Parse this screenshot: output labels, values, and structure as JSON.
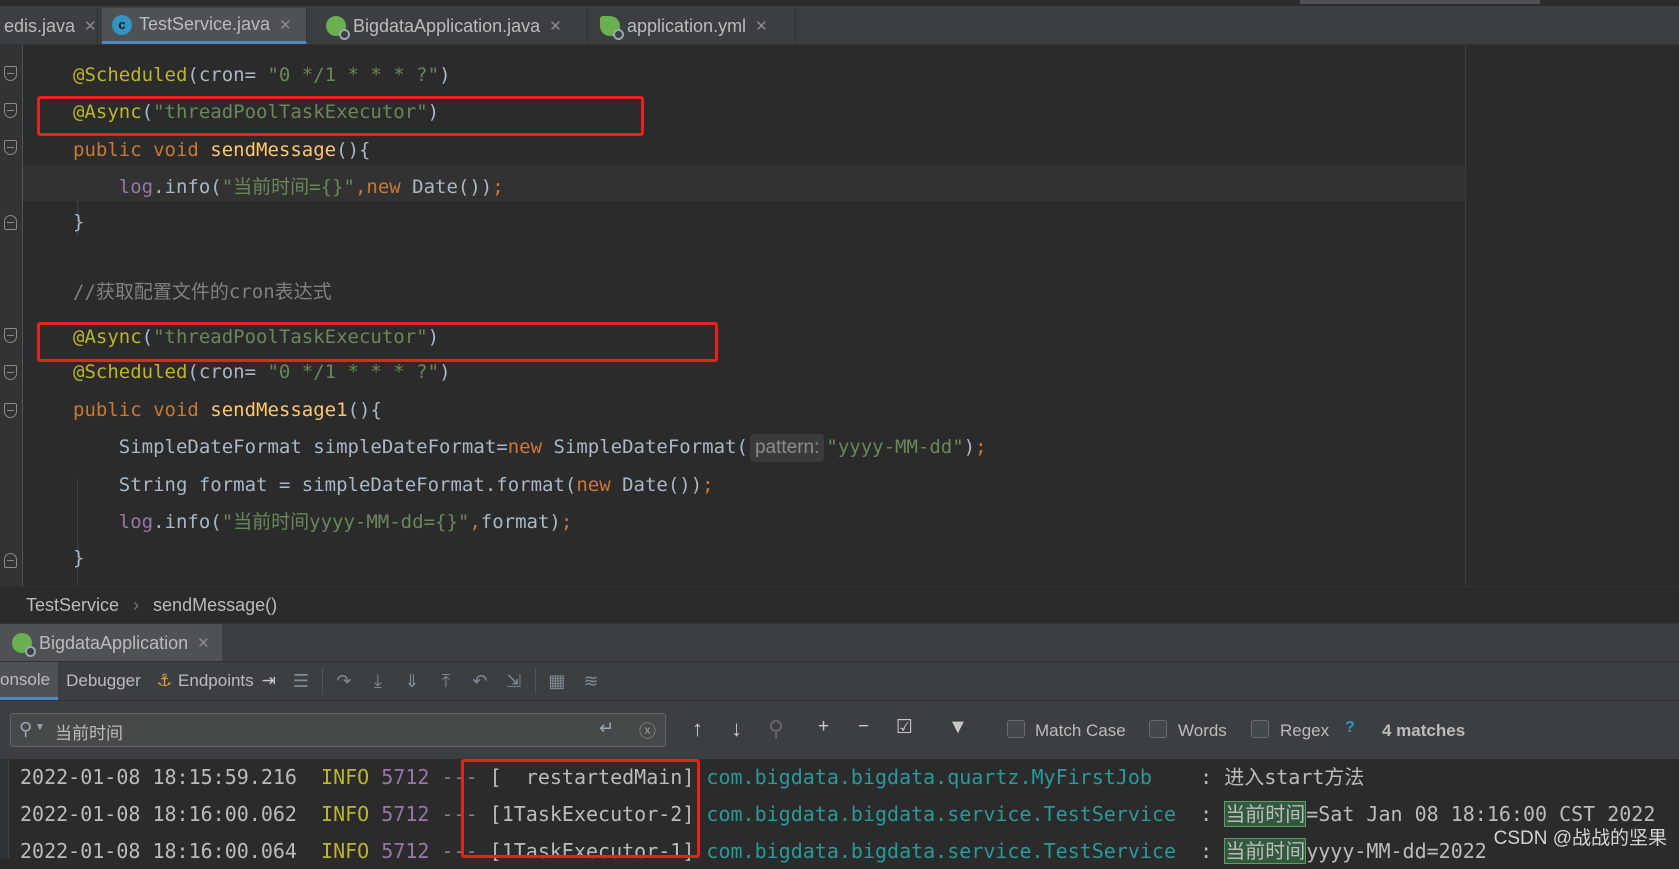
{
  "tabs": [
    {
      "label": "edis.java",
      "icon": "class-icon",
      "active": false
    },
    {
      "label": "TestService.java",
      "icon": "class-icon",
      "active": true
    },
    {
      "label": "BigdataApplication.java",
      "icon": "spring-boot-icon",
      "active": false
    },
    {
      "label": "application.yml",
      "icon": "spring-icon",
      "active": false
    }
  ],
  "editor": {
    "hint_pattern": "pattern:"
  },
  "breadcrumb": [
    "TestService",
    "sendMessage()"
  ],
  "run": {
    "tab_label": "BigdataApplication"
  },
  "toolbar": {
    "tabs": [
      "onsole",
      "Debugger",
      "Endpoints"
    ]
  },
  "find": {
    "query": "当前时间",
    "match_case": "Match Case",
    "words": "Words",
    "regex": "Regex",
    "help": "?",
    "matches": "4 matches"
  },
  "console": {
    "lines": [
      {
        "ts": "2022-01-08 18:15:59.216",
        "level": "INFO",
        "pid": "5712",
        "sep": "---",
        "thread": "[  restartedMain]",
        "logger": "com.bigdata.bigdata.quartz.MyFirstJob",
        "colon": ":",
        "highlight": "",
        "msg": "进入start方法"
      },
      {
        "ts": "2022-01-08 18:16:00.062",
        "level": "INFO",
        "pid": "5712",
        "sep": "---",
        "thread": "[1TaskExecutor-2]",
        "logger": "com.bigdata.bigdata.service.TestService",
        "colon": ":",
        "highlight": "当前时间",
        "msg": "=Sat Jan 08 18:16:00 CST 2022"
      },
      {
        "ts": "2022-01-08 18:16:00.064",
        "level": "INFO",
        "pid": "5712",
        "sep": "---",
        "thread": "[1TaskExecutor-1]",
        "logger": "com.bigdata.bigdata.service.TestService",
        "colon": ":",
        "highlight": "当前时间",
        "msg": "yyyy-MM-dd=2022"
      }
    ],
    "watermark": "CSDN @战战的坚果"
  },
  "colors": {
    "accent": "#4a88c7",
    "red_box": "#e8211c",
    "annotation": "#bbb529",
    "string": "#6a8759",
    "keyword": "#cc7832"
  }
}
